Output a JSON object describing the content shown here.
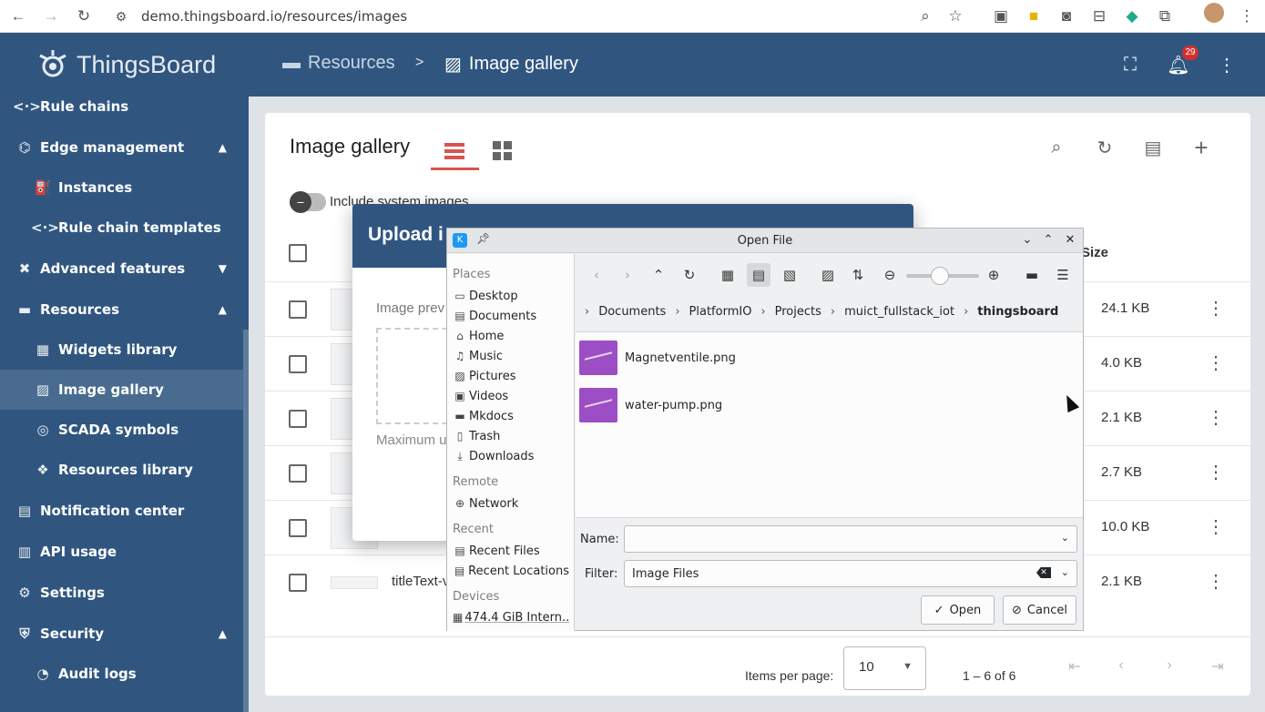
{
  "browser": {
    "url": "demo.thingsboard.io/resources/images"
  },
  "app": {
    "logo_text": "ThingsBoard"
  },
  "sidebar": {
    "items": [
      {
        "label": "Rule chains",
        "icon": "rule-chain-icon"
      },
      {
        "label": "Edge management",
        "icon": "edge-icon",
        "expanded": true
      },
      {
        "label": "Instances",
        "icon": "router-icon"
      },
      {
        "label": "Rule chain templates",
        "icon": "rule-chain-icon"
      },
      {
        "label": "Advanced features",
        "icon": "tools-icon",
        "expanded": false
      },
      {
        "label": "Resources",
        "icon": "folder-icon",
        "expanded": true
      },
      {
        "label": "Widgets library",
        "icon": "widgets-icon"
      },
      {
        "label": "Image gallery",
        "icon": "image-icon",
        "active": true
      },
      {
        "label": "SCADA symbols",
        "icon": "scada-icon"
      },
      {
        "label": "Resources library",
        "icon": "resources-icon"
      },
      {
        "label": "Notification center",
        "icon": "notification-icon"
      },
      {
        "label": "API usage",
        "icon": "chart-icon"
      },
      {
        "label": "Settings",
        "icon": "gear-icon"
      },
      {
        "label": "Security",
        "icon": "shield-icon",
        "expanded": true
      },
      {
        "label": "Audit logs",
        "icon": "audit-icon"
      }
    ]
  },
  "topbar": {
    "crumb_resources": "Resources",
    "crumb_separator": ">",
    "crumb_gallery": "Image gallery",
    "notification_count": "29"
  },
  "gallery": {
    "title": "Image gallery",
    "toggle_label": "Include system images",
    "size_header": "Size",
    "rows": [
      {
        "name": "",
        "size": "24.1 KB"
      },
      {
        "name": "",
        "size": "4.0 KB"
      },
      {
        "name": "",
        "size": "2.1 KB"
      },
      {
        "name": "",
        "size": "2.7 KB"
      },
      {
        "name": "",
        "size": "10.0 KB"
      },
      {
        "name": "titleText-v",
        "size": "2.1 KB"
      }
    ],
    "items_per_page_label": "Items per page:",
    "items_per_page": "10",
    "range": "1 – 6 of 6"
  },
  "upload_dialog": {
    "title": "Upload i",
    "preview_label": "Image prev",
    "max_label": "Maximum u"
  },
  "file_dialog": {
    "title": "Open File",
    "places_header": "Places",
    "places": [
      {
        "label": "Desktop",
        "icon": "desktop-icon"
      },
      {
        "label": "Documents",
        "icon": "documents-icon"
      },
      {
        "label": "Home",
        "icon": "home-icon"
      },
      {
        "label": "Music",
        "icon": "music-icon"
      },
      {
        "label": "Pictures",
        "icon": "pictures-icon"
      },
      {
        "label": "Videos",
        "icon": "videos-icon"
      },
      {
        "label": "Mkdocs",
        "icon": "folder-icon"
      },
      {
        "label": "Trash",
        "icon": "trash-icon"
      },
      {
        "label": "Downloads",
        "icon": "downloads-icon"
      }
    ],
    "remote_header": "Remote",
    "remote": [
      {
        "label": "Network",
        "icon": "network-icon"
      }
    ],
    "recent_header": "Recent",
    "recent": [
      {
        "label": "Recent Files",
        "icon": "recent-files-icon"
      },
      {
        "label": "Recent Locations",
        "icon": "recent-locations-icon"
      }
    ],
    "devices_header": "Devices",
    "devices": [
      {
        "label": "474.4 GiB Intern...",
        "icon": "drive-icon"
      }
    ],
    "breadcrumb": [
      "Documents",
      "PlatformIO",
      "Projects",
      "muict_fullstack_iot",
      "thingsboard"
    ],
    "files": [
      {
        "name": "Magnetventile.png"
      },
      {
        "name": "water-pump.png"
      }
    ],
    "name_label": "Name:",
    "name_value": "",
    "filter_label": "Filter:",
    "filter_value": "Image Files",
    "open_label": "Open",
    "cancel_label": "Cancel"
  }
}
